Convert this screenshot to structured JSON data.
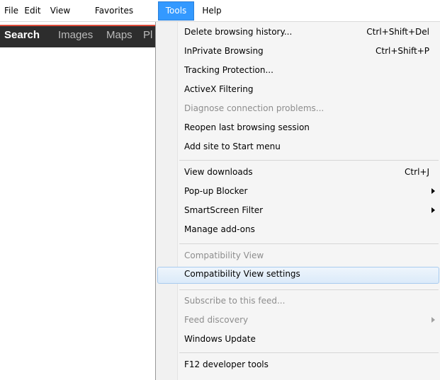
{
  "menubar": {
    "items": [
      "File",
      "Edit",
      "View",
      "Favorites",
      "Tools",
      "Help"
    ]
  },
  "googlebar": {
    "links": [
      "Search",
      "Images",
      "Maps",
      "Pl"
    ]
  },
  "tools_menu": {
    "groups": [
      [
        {
          "label": "Delete browsing history...",
          "shortcut": "Ctrl+Shift+Del"
        },
        {
          "label": "InPrivate Browsing",
          "shortcut": "Ctrl+Shift+P"
        },
        {
          "label": "Tracking Protection..."
        },
        {
          "label": "ActiveX Filtering"
        },
        {
          "label": "Diagnose connection problems...",
          "disabled": true
        },
        {
          "label": "Reopen last browsing session"
        },
        {
          "label": "Add site to Start menu"
        }
      ],
      [
        {
          "label": "View downloads",
          "shortcut": "Ctrl+J"
        },
        {
          "label": "Pop-up Blocker",
          "submenu": true
        },
        {
          "label": "SmartScreen Filter",
          "submenu": true
        },
        {
          "label": "Manage add-ons"
        }
      ],
      [
        {
          "label": "Compatibility View",
          "disabled": true
        },
        {
          "label": "Compatibility View settings",
          "highlighted": true
        }
      ],
      [
        {
          "label": "Subscribe to this feed...",
          "disabled": true
        },
        {
          "label": "Feed discovery",
          "disabled": true,
          "submenu": true
        },
        {
          "label": "Windows Update"
        }
      ],
      [
        {
          "label": "F12 developer tools"
        }
      ]
    ]
  },
  "colors": {
    "menu_active": "#3399ff",
    "google_bar": "#2d2d2d",
    "google_accent": "#dd4b39",
    "highlight_border": "#a8cbef"
  }
}
